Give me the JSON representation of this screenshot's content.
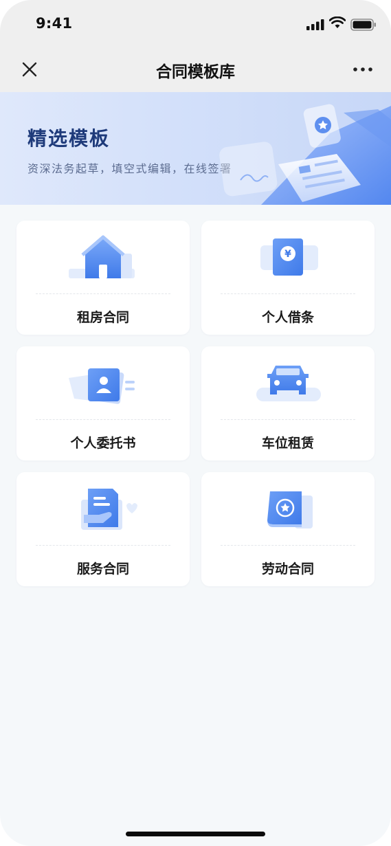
{
  "status_bar": {
    "time": "9:41"
  },
  "nav": {
    "title": "合同模板库"
  },
  "banner": {
    "title": "精选模板",
    "subtitle": "资深法务起草，填空式编辑，在线签署"
  },
  "templates": [
    {
      "label": "租房合同",
      "icon": "house-icon"
    },
    {
      "label": "个人借条",
      "icon": "yuan-note-icon"
    },
    {
      "label": "个人委托书",
      "icon": "person-card-icon"
    },
    {
      "label": "车位租赁",
      "icon": "car-icon"
    },
    {
      "label": "服务合同",
      "icon": "handshake-document-icon"
    },
    {
      "label": "劳动合同",
      "icon": "star-certificate-icon"
    }
  ],
  "colors": {
    "accent": "#4a86f0",
    "accent_light": "#a9c6fb",
    "page_bg": "#f5f8fa",
    "banner_title": "#1e3a7a"
  }
}
